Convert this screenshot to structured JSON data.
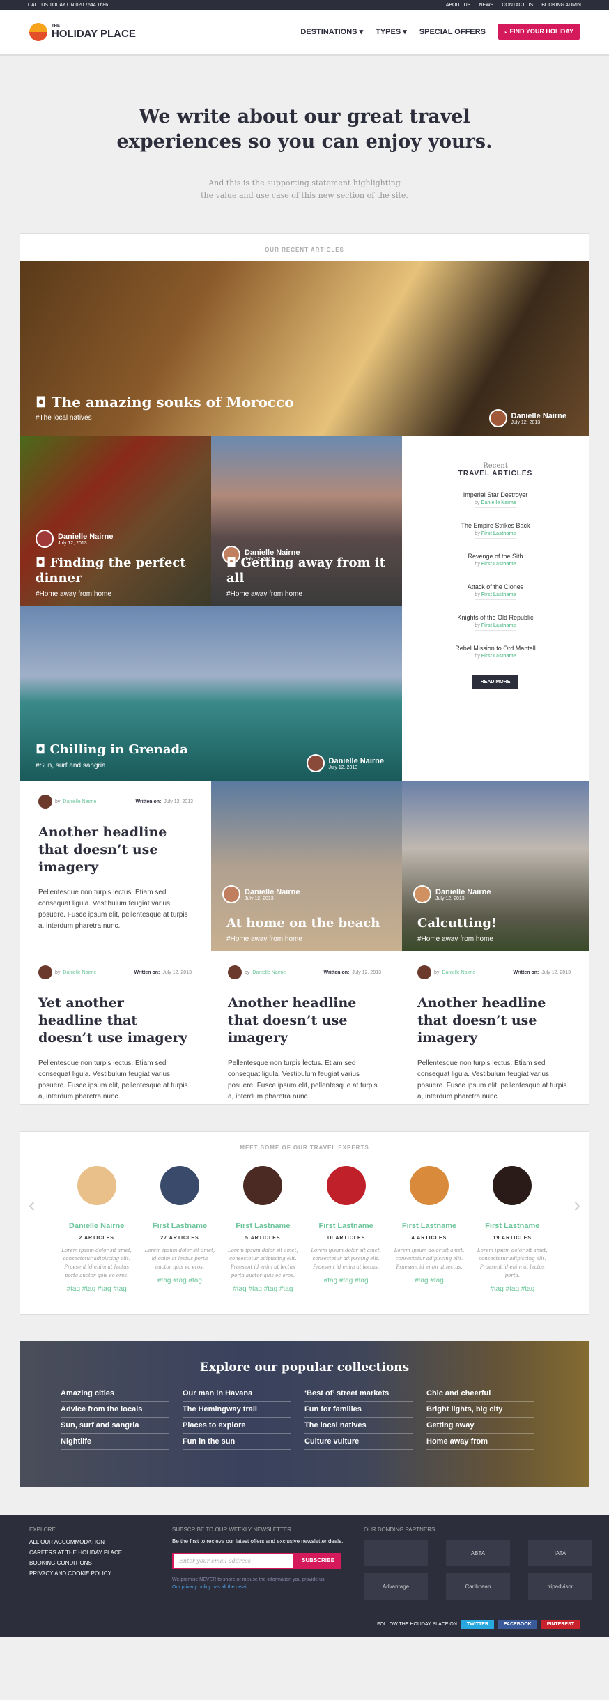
{
  "topbar": {
    "call": "CALL US TODAY ON 020 7644 1686",
    "links": [
      "ABOUT US",
      "NEWS",
      "CONTACT US",
      "BOOKING ADMIN"
    ]
  },
  "logo": {
    "small": "THE",
    "main": "HOLIDAY PLACE"
  },
  "nav": {
    "items": [
      "DESTINATIONS",
      "TYPES",
      "SPECIAL OFFERS"
    ],
    "cta": "FIND YOUR HOLIDAY"
  },
  "hero": {
    "title": "We write about our great travel experiences so you can enjoy yours.",
    "sub1": "And this is the supporting statement highlighting",
    "sub2": "the value and use case of this new section of the site."
  },
  "recent_title": "OUR RECENT ARTICLES",
  "tiles": {
    "morocco": {
      "title": "The amazing souks of Morocco",
      "tag": "#The local natives",
      "author": "Danielle Nairne",
      "date": "July 12, 2013"
    },
    "dinner": {
      "title": "Finding the perfect dinner",
      "tag": "#Home away from home",
      "author": "Danielle Nairne",
      "date": "July 12, 2013"
    },
    "away": {
      "title": "Getting away from it all",
      "tag": "#Home away from home",
      "author": "Danielle Nairne",
      "date": "July 12, 2013"
    },
    "grenada": {
      "title": "Chilling in Grenada",
      "tag": "#Sun, surf and sangria",
      "author": "Danielle Nairne",
      "date": "July 12, 2013"
    },
    "beach": {
      "title": "At home on the beach",
      "tag": "#Home away from home",
      "author": "Danielle Nairne",
      "date": "July 12, 2013"
    },
    "calcutta": {
      "title": "Calcutting!",
      "tag": "#Home away from home",
      "author": "Danielle Nairne",
      "date": "July 12, 2013"
    }
  },
  "recent": {
    "small": "Recent",
    "title": "TRAVEL ARTICLES",
    "by": "by",
    "items": [
      {
        "t": "Imperial Star Destroyer",
        "a": "Danielle Nairne"
      },
      {
        "t": "The Empire Strikes Back",
        "a": "First Lastname"
      },
      {
        "t": "Revenge of the Sith",
        "a": "First Lastname"
      },
      {
        "t": "Attack of the Clones",
        "a": "First Lastname"
      },
      {
        "t": "Knights of the Old Republic",
        "a": "First Lastname"
      },
      {
        "t": "Rebel Mission to Ord Mantell",
        "a": "First Lastname"
      }
    ],
    "button": "READ MORE"
  },
  "articles": [
    {
      "by": "by",
      "author": "Danielle Nairne",
      "written": "Written on:",
      "date": "July 12, 2013",
      "title": "Another headline that doesn’t use imagery",
      "body": "Pellentesque non turpis lectus. Etiam sed consequat ligula. Vestibulum feugiat varius posuere. Fusce ipsum elit, pellentesque at turpis a, interdum pharetra nunc."
    },
    {
      "by": "by",
      "author": "Danielle Nairne",
      "written": "Written on:",
      "date": "July 12, 2013",
      "title": "Yet another headline that doesn’t use imagery",
      "body": "Pellentesque non turpis lectus. Etiam sed consequat ligula. Vestibulum feugiat varius posuere. Fusce ipsum elit, pellentesque at turpis a, interdum pharetra nunc."
    },
    {
      "by": "by",
      "author": "Danielle Nairne",
      "written": "Written on:",
      "date": "July 12, 2013",
      "title": "Another headline that doesn’t use imagery",
      "body": "Pellentesque non turpis lectus. Etiam sed consequat ligula. Vestibulum feugiat varius posuere. Fusce ipsum elit, pellentesque at turpis a, interdum pharetra nunc."
    },
    {
      "by": "by",
      "author": "Danielle Nairne",
      "written": "Written on:",
      "date": "July 12, 2013",
      "title": "Another headline that doesn’t use imagery",
      "body": "Pellentesque non turpis lectus. Etiam sed consequat ligula. Vestibulum feugiat varius posuere. Fusce ipsum elit, pellentesque at turpis a, interdum pharetra nunc."
    }
  ],
  "experts_title": "MEET SOME OF OUR TRAVEL EXPERTS",
  "experts": [
    {
      "n": "Danielle Nairne",
      "c": "2 ARTICLES",
      "d": "Lorem ipsum dolor sit amet, consectetur adipiscing elit. Praesent id enim at lectus porta auctor quis ec eros.",
      "tags": "#tag #tag #tag #tag",
      "col": "#e9c08a"
    },
    {
      "n": "First Lastname",
      "c": "27 ARTICLES",
      "d": "Lorem ipsum dolor sit amet, id enim at lectus porta auctor quis ec eros.",
      "tags": "#tag #tag #tag",
      "col": "#3a4a6a"
    },
    {
      "n": "First Lastname",
      "c": "5 ARTICLES",
      "d": "Lorem ipsum dolor sit amet, consectetur adipiscing elit. Praesent id enim at lectus porta auctor quis ec eros.",
      "tags": "#tag #tag #tag #tag",
      "col": "#4a2a22"
    },
    {
      "n": "First Lastname",
      "c": "10 ARTICLES",
      "d": "Lorem ipsum dolor sit amet, consectetur adipiscing elit. Praesent id enim at lectus.",
      "tags": "#tag #tag #tag",
      "col": "#c0202a"
    },
    {
      "n": "First Lastname",
      "c": "4 ARTICLES",
      "d": "Lorem ipsum dolor sit amet, consectetur adipiscing elit. Praesent id enim at lectus.",
      "tags": "#tag #tag",
      "col": "#d98a3a"
    },
    {
      "n": "First Lastname",
      "c": "19 ARTICLES",
      "d": "Lorem ipsum dolor sit amet, consectetur adipiscing elit. Praesent id enim at lectus porta.",
      "tags": "#tag #tag #tag",
      "col": "#2a1a18"
    }
  ],
  "collections": {
    "title": "Explore our popular collections",
    "cols": [
      [
        "Amazing cities",
        "Advice from the locals",
        "Sun, surf and sangria",
        "Nightlife"
      ],
      [
        "Our man in Havana",
        "The Hemingway trail",
        "Places to explore",
        "Fun in the sun"
      ],
      [
        "‘Best of’ street markets",
        "Fun for families",
        "The local natives",
        "Culture vulture"
      ],
      [
        "Chic and cheerful",
        "Bright lights, big city",
        "Getting away",
        "Home away from"
      ]
    ]
  },
  "footer": {
    "explore": "EXPLORE",
    "links": [
      "ALL OUR ACCOMMODATION",
      "CAREERS AT THE HOLIDAY PLACE",
      "BOOKING CONDITIONS",
      "PRIVACY AND COOKIE POLICY"
    ],
    "news_title": "SUBSCRIBE TO OUR WEEKLY NEWSLETTER",
    "news_text": "Be the first to recieve our latest offers and exclusive newsletter deals.",
    "placeholder": "Enter your email address",
    "subscribe": "SUBSCRIBE",
    "promise": "We promise NEVER to share or misuse the information you provide us.",
    "privacy": "Our privacy policy has all the detail.",
    "partners_title": "OUR BONDING PARTNERS",
    "partners": [
      "",
      "ABTA",
      "IATA",
      "Advantage",
      "Caribbean",
      "tripadvisor"
    ],
    "follow": "FOLLOW THE HOLIDAY PLACE ON",
    "social": [
      "TWITTER",
      "FACEBOOK",
      "PINTEREST"
    ]
  }
}
